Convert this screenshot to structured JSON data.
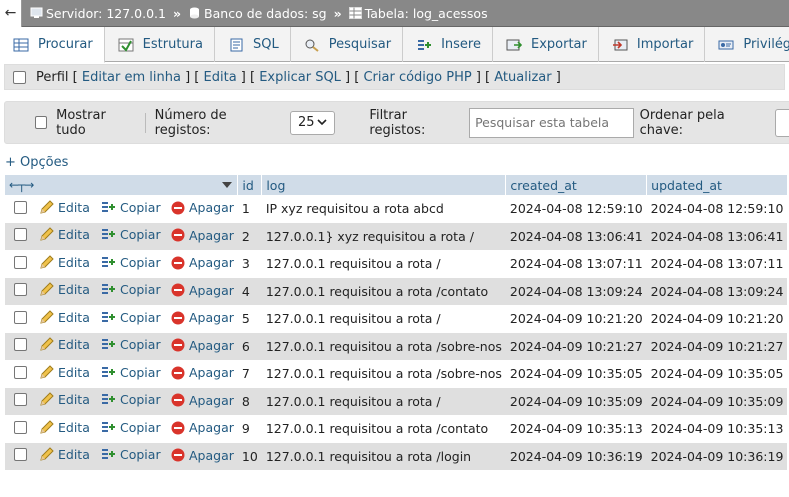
{
  "breadcrumb": {
    "server": "Servidor: 127.0.0.1",
    "database": "Banco de dados: sg",
    "table": "Tabela: log_acessos",
    "separator": "»"
  },
  "tabs": [
    {
      "label": "Procurar",
      "icon": "browse-icon",
      "active": true
    },
    {
      "label": "Estrutura",
      "icon": "structure-icon"
    },
    {
      "label": "SQL",
      "icon": "sql-icon"
    },
    {
      "label": "Pesquisar",
      "icon": "search-icon"
    },
    {
      "label": "Insere",
      "icon": "insert-icon"
    },
    {
      "label": "Exportar",
      "icon": "export-icon"
    },
    {
      "label": "Importar",
      "icon": "import-icon"
    },
    {
      "label": "Privilégios",
      "icon": "privileges-icon"
    }
  ],
  "perfil": {
    "label": "Perfil",
    "links": [
      "Editar em linha",
      "Edita",
      "Explicar SQL",
      "Criar código PHP",
      "Atualizar"
    ]
  },
  "navigation": {
    "show_all": "Mostrar tudo",
    "num_records_label": "Número de registos:",
    "num_records_value": "25",
    "filter_label": "Filtrar registos:",
    "filter_placeholder": "Pesquisar esta tabela",
    "sort_label": "Ordenar pela chave:"
  },
  "options_link": "+ Opções",
  "table": {
    "columns": [
      "id",
      "log",
      "created_at",
      "updated_at"
    ],
    "action_labels": {
      "edit": "Edita",
      "copy": "Copiar",
      "delete": "Apagar"
    },
    "rows": [
      {
        "id": "1",
        "log": "IP xyz requisitou a rota abcd",
        "created_at": "2024-04-08 12:59:10",
        "updated_at": "2024-04-08 12:59:10"
      },
      {
        "id": "2",
        "log": "127.0.0.1} xyz requisitou a rota /",
        "created_at": "2024-04-08 13:06:41",
        "updated_at": "2024-04-08 13:06:41"
      },
      {
        "id": "3",
        "log": "127.0.0.1 requisitou a rota /",
        "created_at": "2024-04-08 13:07:11",
        "updated_at": "2024-04-08 13:07:11"
      },
      {
        "id": "4",
        "log": "127.0.0.1 requisitou a rota /contato",
        "created_at": "2024-04-08 13:09:24",
        "updated_at": "2024-04-08 13:09:24"
      },
      {
        "id": "5",
        "log": "127.0.0.1 requisitou a rota /",
        "created_at": "2024-04-09 10:21:20",
        "updated_at": "2024-04-09 10:21:20"
      },
      {
        "id": "6",
        "log": "127.0.0.1 requisitou a rota /sobre-nos",
        "created_at": "2024-04-09 10:21:27",
        "updated_at": "2024-04-09 10:21:27"
      },
      {
        "id": "7",
        "log": "127.0.0.1 requisitou a rota /sobre-nos",
        "created_at": "2024-04-09 10:35:05",
        "updated_at": "2024-04-09 10:35:05"
      },
      {
        "id": "8",
        "log": "127.0.0.1 requisitou a rota /",
        "created_at": "2024-04-09 10:35:09",
        "updated_at": "2024-04-09 10:35:09"
      },
      {
        "id": "9",
        "log": "127.0.0.1 requisitou a rota /contato",
        "created_at": "2024-04-09 10:35:13",
        "updated_at": "2024-04-09 10:35:13"
      },
      {
        "id": "10",
        "log": "127.0.0.1 requisitou a rota /login",
        "created_at": "2024-04-09 10:36:19",
        "updated_at": "2024-04-09 10:36:19"
      }
    ]
  },
  "colors": {
    "link": "#235a81",
    "header_bg": "#d0dce8",
    "row_alt": "#dfdfdf",
    "delete_icon": "#d9342b"
  }
}
